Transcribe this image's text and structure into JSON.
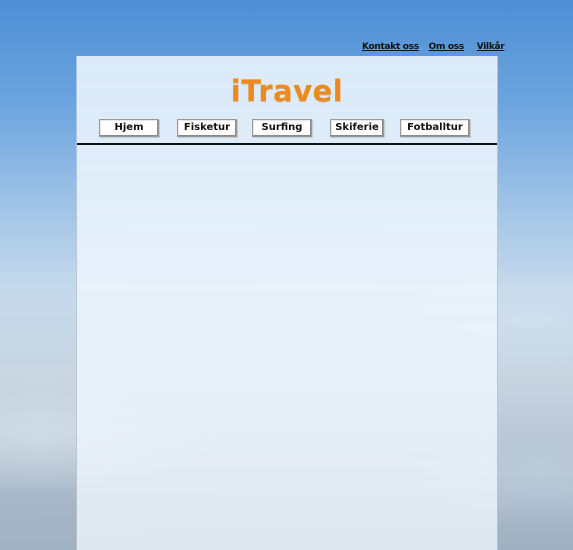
{
  "top_links": [
    "Kontakt oss",
    "Om oss",
    "Vilkår"
  ],
  "logo": "iTravel",
  "nav": [
    "Hjem",
    "Fisketur",
    "Surfing",
    "Skiferie",
    "Fotballtur"
  ],
  "colors": {
    "logo": "#ee8a1c",
    "rule": "#111111",
    "sky_top": "#4f8fd6"
  }
}
